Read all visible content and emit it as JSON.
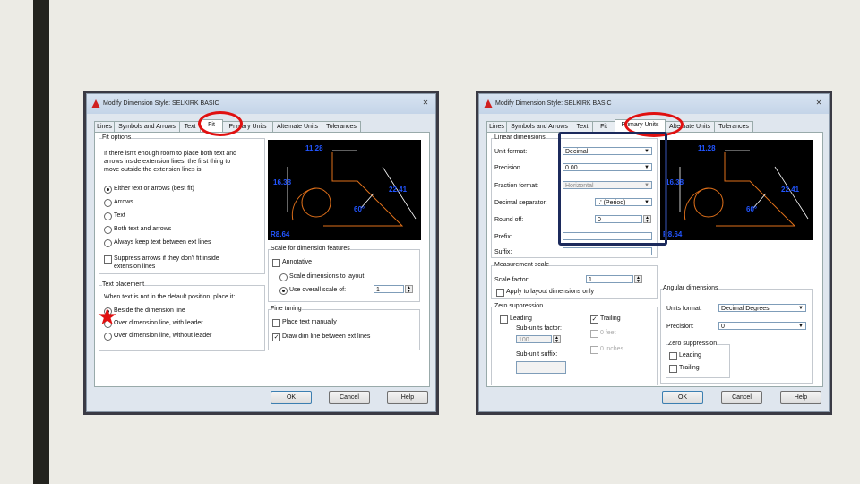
{
  "colors": {
    "slide_bg": "#ecebe5",
    "sidebar": "#23231e",
    "highlight_red": "#e01010",
    "highlight_navy": "#1c2a5c",
    "preview_dim": "#2255ff",
    "preview_line": "#e0701a"
  },
  "left": {
    "title": "Modify Dimension Style: SELKIRK BASIC",
    "tabs": [
      "Lines",
      "Symbols and Arrows",
      "Text",
      "Fit",
      "Primary Units",
      "Alternate Units",
      "Tolerances"
    ],
    "fit_options": {
      "group": "Fit options",
      "desc": [
        "If there isn't enough room to place both text and",
        "arrows inside extension lines, the first thing to",
        "move outside the extension lines is:"
      ],
      "options": [
        "Either text or arrows (best fit)",
        "Arrows",
        "Text",
        "Both text and arrows",
        "Always keep text between ext lines"
      ],
      "suppress": [
        "Suppress arrows if they don't fit inside",
        "extension lines"
      ]
    },
    "text_placement": {
      "group": "Text placement",
      "desc": "When text is not in the default position, place it:",
      "options": [
        "Beside the dimension line",
        "Over dimension line, with leader",
        "Over dimension line, without leader"
      ]
    },
    "scale": {
      "group": "Scale for dimension features",
      "annotative": "Annotative",
      "layout": "Scale dimensions to layout",
      "overall": "Use overall scale of:",
      "value": "1"
    },
    "fine": {
      "group": "Fine tuning",
      "manual": "Place text manually",
      "draw": "Draw dim line between ext lines"
    },
    "preview": {
      "d1": "11.28",
      "d2": "16.38",
      "d3": "22.41",
      "d4": "60°",
      "d5": "R8.64"
    },
    "buttons": {
      "ok": "OK",
      "cancel": "Cancel",
      "help": "Help"
    }
  },
  "right": {
    "title": "Modify Dimension Style: SELKIRK BASIC",
    "tabs": [
      "Lines",
      "Symbols and Arrows",
      "Text",
      "Fit",
      "Primary Units",
      "Alternate Units",
      "Tolerances"
    ],
    "linear": {
      "group": "Linear dimensions",
      "unit_format_label": "Unit format:",
      "unit_format_value": "Decimal",
      "precision_label": "Precision",
      "precision_value": "0.00",
      "fraction_label": "Fraction format:",
      "fraction_value": "Horizontal",
      "decimal_label": "Decimal separator:",
      "decimal_value": "'.' (Period)",
      "round_label": "Round off:",
      "round_value": "0",
      "prefix_label": "Prefix:",
      "suffix_label": "Suffix:"
    },
    "measurement": {
      "group": "Measurement scale",
      "scale_label": "Scale factor:",
      "scale_value": "1",
      "apply": "Apply to layout dimensions only"
    },
    "zero": {
      "group": "Zero suppression",
      "leading": "Leading",
      "trailing": "Trailing",
      "sub_factor_label": "Sub-units factor:",
      "sub_factor_value": "100",
      "feet": "0 feet",
      "inches": "0 inches",
      "sub_suffix_label": "Sub-unit suffix:"
    },
    "angular": {
      "group": "Angular dimensions",
      "unit_label": "Units format:",
      "unit_value": "Decimal Degrees",
      "precision_label": "Precision:",
      "precision_value": "0",
      "zero_group": "Zero suppression",
      "leading": "Leading",
      "trailing": "Trailing"
    },
    "preview": {
      "d1": "11.28",
      "d2": "16.38",
      "d3": "22.41",
      "d4": "60°",
      "d5": "R8.64"
    },
    "buttons": {
      "ok": "OK",
      "cancel": "Cancel",
      "help": "Help"
    }
  }
}
